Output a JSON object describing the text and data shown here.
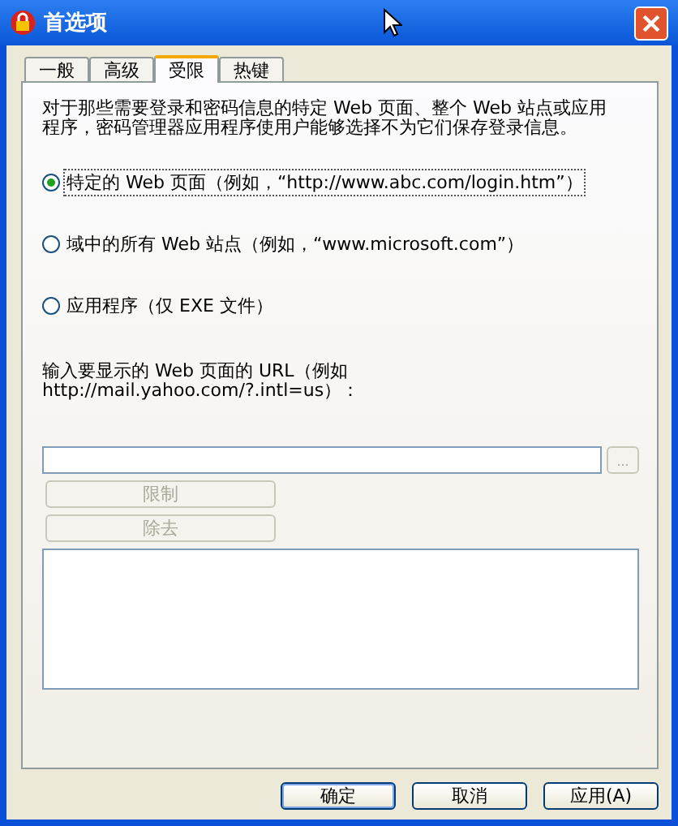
{
  "window": {
    "title": "首选项"
  },
  "tabs": [
    {
      "label": "一般",
      "selected": false
    },
    {
      "label": "高级",
      "selected": false
    },
    {
      "label": "受限",
      "selected": true
    },
    {
      "label": "热键",
      "selected": false
    }
  ],
  "description": "对于那些需要登录和密码信息的特定 Web 页面、整个 Web 站点或应用程序，密码管理器应用程序使用户能够选择不为它们保存登录信息。",
  "options": [
    {
      "label": "特定的 Web 页面（例如，“http://www.abc.com/login.htm”）",
      "selected": true
    },
    {
      "label": "域中的所有 Web 站点（例如，“www.microsoft.com”）",
      "selected": false
    },
    {
      "label": "应用程序（仅 EXE 文件）",
      "selected": false
    }
  ],
  "url_prompt": [
    "输入要显示的 Web 页面的 URL（例如",
    "http://mail.yahoo.com/?.intl=us）："
  ],
  "browse_button": "...",
  "action_buttons": [
    {
      "label": "限制",
      "disabled": true
    },
    {
      "label": "除去",
      "disabled": true
    }
  ],
  "dialog_buttons": [
    {
      "label": "确定",
      "default": true
    },
    {
      "label": "取消",
      "default": false
    },
    {
      "label": "应用(A)",
      "default": false
    }
  ]
}
